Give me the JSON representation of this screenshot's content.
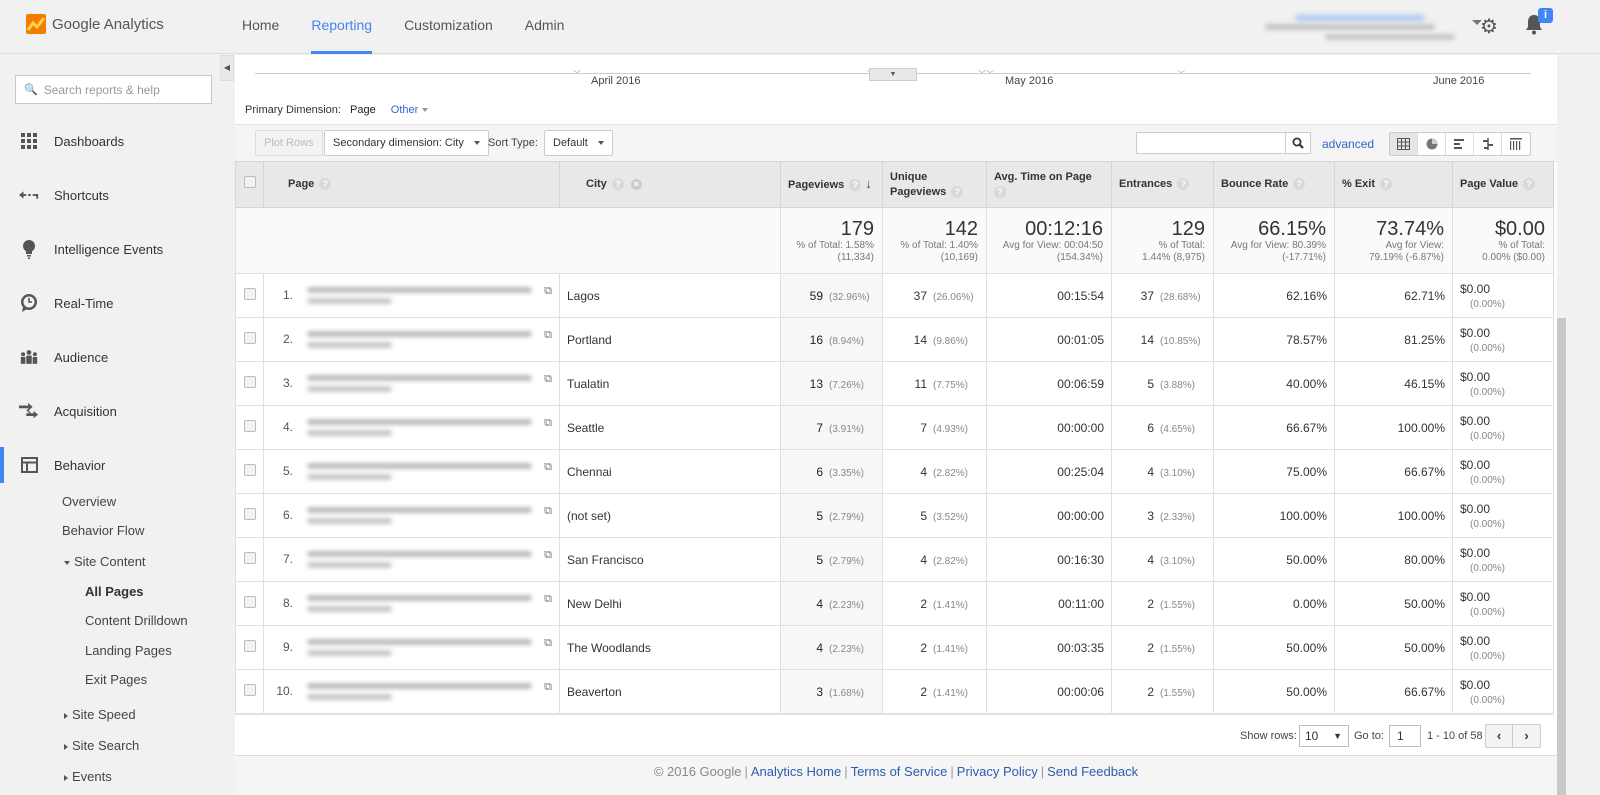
{
  "app": {
    "name": "Google Analytics",
    "brand_color": "#f57c00",
    "accent_color": "#4285f4"
  },
  "topnav": {
    "items": [
      {
        "label": "Home",
        "active": false
      },
      {
        "label": "Reporting",
        "active": true
      },
      {
        "label": "Customization",
        "active": false
      },
      {
        "label": "Admin",
        "active": false
      }
    ],
    "notification_badge": "i"
  },
  "sidebar": {
    "search_placeholder": "Search reports & help",
    "items": [
      {
        "label": "Dashboards",
        "icon": "dashboard-grid-icon"
      },
      {
        "label": "Shortcuts",
        "icon": "shortcut-arrow-icon"
      },
      {
        "label": "Intelligence Events",
        "icon": "lightbulb-icon"
      },
      {
        "label": "Real-Time",
        "icon": "clock-icon"
      },
      {
        "label": "Audience",
        "icon": "people-icon"
      },
      {
        "label": "Acquisition",
        "icon": "acquisition-arrows-icon"
      },
      {
        "label": "Behavior",
        "icon": "behavior-layout-icon",
        "active": true
      }
    ],
    "behavior_sub": {
      "overview": "Overview",
      "behavior_flow": "Behavior Flow",
      "site_content": "Site Content",
      "site_content_children": [
        "All Pages",
        "Content Drilldown",
        "Landing Pages",
        "Exit Pages"
      ],
      "site_speed": "Site Speed",
      "site_search": "Site Search",
      "events": "Events"
    }
  },
  "timeline": {
    "labels": [
      "April 2016",
      "May 2016",
      "June 2016"
    ]
  },
  "primary_dimension": {
    "label": "Primary Dimension:",
    "current": "Page",
    "other": "Other"
  },
  "toolbar": {
    "plot_rows": "Plot Rows",
    "secondary_dimension": "Secondary dimension: City",
    "sort_type_label": "Sort Type:",
    "sort_type_value": "Default",
    "search_value": "",
    "advanced": "advanced"
  },
  "table": {
    "headers": {
      "page": "Page",
      "city": "City",
      "pageviews": "Pageviews",
      "unique_pageviews": "Unique Pageviews",
      "avg_time": "Avg. Time on Page",
      "entrances": "Entrances",
      "bounce_rate": "Bounce Rate",
      "exit": "% Exit",
      "page_value": "Page Value"
    },
    "totals": {
      "pageviews": {
        "value": "179",
        "sub1": "% of Total: 1.58%",
        "sub2": "(11,334)"
      },
      "unique_pageviews": {
        "value": "142",
        "sub1": "% of Total: 1.40%",
        "sub2": "(10,169)"
      },
      "avg_time": {
        "value": "00:12:16",
        "sub1": "Avg for View: 00:04:50",
        "sub2": "(154.34%)"
      },
      "entrances": {
        "value": "129",
        "sub1": "% of Total:",
        "sub2": "1.44% (8,975)"
      },
      "bounce_rate": {
        "value": "66.15%",
        "sub1": "Avg for View: 80.39%",
        "sub2": "(-17.71%)"
      },
      "exit": {
        "value": "73.74%",
        "sub1": "Avg for View:",
        "sub2": "79.19% (-6.87%)"
      },
      "page_value": {
        "value": "$0.00",
        "sub1": "% of Total:",
        "sub2": "0.00% ($0.00)"
      }
    },
    "rows": [
      {
        "n": "1.",
        "city": "Lagos",
        "pv": "59",
        "pv_pct": "(32.96%)",
        "upv": "37",
        "upv_pct": "(26.06%)",
        "time": "00:15:54",
        "ent": "37",
        "ent_pct": "(28.68%)",
        "bounce": "62.16%",
        "exit": "62.71%",
        "value": "$0.00",
        "value_pct": "(0.00%)"
      },
      {
        "n": "2.",
        "city": "Portland",
        "pv": "16",
        "pv_pct": "(8.94%)",
        "upv": "14",
        "upv_pct": "(9.86%)",
        "time": "00:01:05",
        "ent": "14",
        "ent_pct": "(10.85%)",
        "bounce": "78.57%",
        "exit": "81.25%",
        "value": "$0.00",
        "value_pct": "(0.00%)"
      },
      {
        "n": "3.",
        "city": "Tualatin",
        "pv": "13",
        "pv_pct": "(7.26%)",
        "upv": "11",
        "upv_pct": "(7.75%)",
        "time": "00:06:59",
        "ent": "5",
        "ent_pct": "(3.88%)",
        "bounce": "40.00%",
        "exit": "46.15%",
        "value": "$0.00",
        "value_pct": "(0.00%)"
      },
      {
        "n": "4.",
        "city": "Seattle",
        "pv": "7",
        "pv_pct": "(3.91%)",
        "upv": "7",
        "upv_pct": "(4.93%)",
        "time": "00:00:00",
        "ent": "6",
        "ent_pct": "(4.65%)",
        "bounce": "66.67%",
        "exit": "100.00%",
        "value": "$0.00",
        "value_pct": "(0.00%)"
      },
      {
        "n": "5.",
        "city": "Chennai",
        "pv": "6",
        "pv_pct": "(3.35%)",
        "upv": "4",
        "upv_pct": "(2.82%)",
        "time": "00:25:04",
        "ent": "4",
        "ent_pct": "(3.10%)",
        "bounce": "75.00%",
        "exit": "66.67%",
        "value": "$0.00",
        "value_pct": "(0.00%)"
      },
      {
        "n": "6.",
        "city": "(not set)",
        "pv": "5",
        "pv_pct": "(2.79%)",
        "upv": "5",
        "upv_pct": "(3.52%)",
        "time": "00:00:00",
        "ent": "3",
        "ent_pct": "(2.33%)",
        "bounce": "100.00%",
        "exit": "100.00%",
        "value": "$0.00",
        "value_pct": "(0.00%)"
      },
      {
        "n": "7.",
        "city": "San Francisco",
        "pv": "5",
        "pv_pct": "(2.79%)",
        "upv": "4",
        "upv_pct": "(2.82%)",
        "time": "00:16:30",
        "ent": "4",
        "ent_pct": "(3.10%)",
        "bounce": "50.00%",
        "exit": "80.00%",
        "value": "$0.00",
        "value_pct": "(0.00%)"
      },
      {
        "n": "8.",
        "city": "New Delhi",
        "pv": "4",
        "pv_pct": "(2.23%)",
        "upv": "2",
        "upv_pct": "(1.41%)",
        "time": "00:11:00",
        "ent": "2",
        "ent_pct": "(1.55%)",
        "bounce": "0.00%",
        "exit": "50.00%",
        "value": "$0.00",
        "value_pct": "(0.00%)"
      },
      {
        "n": "9.",
        "city": "The Woodlands",
        "pv": "4",
        "pv_pct": "(2.23%)",
        "upv": "2",
        "upv_pct": "(1.41%)",
        "time": "00:03:35",
        "ent": "2",
        "ent_pct": "(1.55%)",
        "bounce": "50.00%",
        "exit": "50.00%",
        "value": "$0.00",
        "value_pct": "(0.00%)"
      },
      {
        "n": "10.",
        "city": "Beaverton",
        "pv": "3",
        "pv_pct": "(1.68%)",
        "upv": "2",
        "upv_pct": "(1.41%)",
        "time": "00:00:06",
        "ent": "2",
        "ent_pct": "(1.55%)",
        "bounce": "50.00%",
        "exit": "66.67%",
        "value": "$0.00",
        "value_pct": "(0.00%)"
      }
    ]
  },
  "pagination": {
    "show_rows_label": "Show rows:",
    "show_rows_value": "10",
    "goto_label": "Go to:",
    "goto_value": "1",
    "range": "1 - 10 of 58"
  },
  "footer": {
    "copyright": "© 2016 Google",
    "links": [
      "Analytics Home",
      "Terms of Service",
      "Privacy Policy",
      "Send Feedback"
    ]
  }
}
